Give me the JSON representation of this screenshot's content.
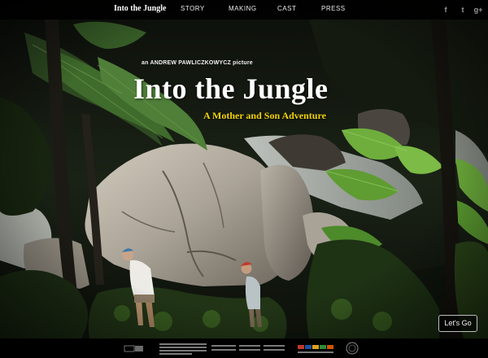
{
  "nav": {
    "brand": "Into the Jungle",
    "items": [
      {
        "label": "STORY"
      },
      {
        "label": "MAKING"
      },
      {
        "label": "CAST"
      },
      {
        "label": "PRESS"
      }
    ]
  },
  "social": {
    "icons": [
      "facebook-icon",
      "twitter-icon",
      "google-plus-icon"
    ],
    "glyphs": [
      "f",
      "t",
      "g+"
    ]
  },
  "hero": {
    "credit": "an ANDREW PAWLICZKOWYCZ picture",
    "title": "Into the Jungle",
    "tagline": "A Mother and Son Adventure"
  },
  "cta": {
    "label": "Let's Go"
  },
  "colors": {
    "tagline": "#f2d20a",
    "nav_bg": "#000000",
    "nav_text": "#eaeaea",
    "social_icon": "#9a9a9a"
  }
}
